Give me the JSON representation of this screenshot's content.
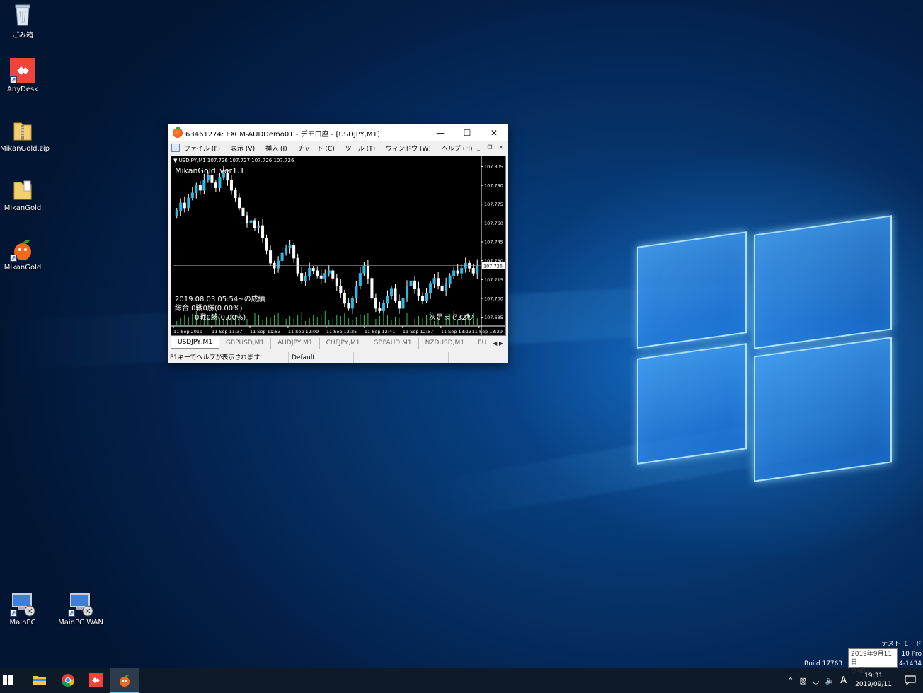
{
  "desktop": {
    "icons": [
      {
        "name": "recycle-bin",
        "label": "ごみ箱"
      },
      {
        "name": "anydesk",
        "label": "AnyDesk"
      },
      {
        "name": "mikangold-zip",
        "label": "MikanGold.zip"
      },
      {
        "name": "mikangold-folder",
        "label": "MikanGold"
      },
      {
        "name": "mikangold-app",
        "label": "MikanGold"
      },
      {
        "name": "mainpc",
        "label": "MainPC"
      },
      {
        "name": "mainpc-wan",
        "label": "MainPC WAN"
      }
    ],
    "watermark": {
      "line1": "テスト モード",
      "line2": "10 Pro",
      "line3_prefix": "Build 17763",
      "line3_suffix": "4-1434"
    }
  },
  "mt4": {
    "title": "63461274: FXCM-AUDDemo01 - デモ口座 - [USDJPY,M1]",
    "menu": [
      "ファイル (F)",
      "表示 (V)",
      "挿入 (I)",
      "チャート (C)",
      "ツール (T)",
      "ウィンドウ (W)",
      "ヘルプ (H)"
    ],
    "chart": {
      "header": "USDJPY,M1  107.726 107.727 107.726 107.726",
      "ea_name": "MikanGold_ver1.1",
      "stats_line1": "2019.08.03 05:54~の成績",
      "stats_line2": "総合 0戦0勝(0.00%)",
      "stats_line3": "0戦0勝(0.00%)",
      "countdown": "次足まで32秒",
      "current_price": "107.726"
    },
    "tabs": [
      "USDJPY,M1",
      "GBPUSD,M1",
      "AUDJPY,M1",
      "CHFJPY,M1",
      "GBPAUD,M1",
      "NZDUSD,M1",
      "EU"
    ],
    "active_tab": 0,
    "status": {
      "help": "F1キーでヘルプが表示されます",
      "profile": "Default"
    }
  },
  "chart_data": {
    "type": "candlestick",
    "symbol": "USDJPY",
    "timeframe": "M1",
    "ylim": [
      107.678,
      107.812
    ],
    "y_ticks": [
      "107.805",
      "107.790",
      "107.775",
      "107.760",
      "107.745",
      "107.730",
      "107.715",
      "107.700",
      "107.685"
    ],
    "x_ticks": [
      "11 Sep 2019",
      "11 Sep 11:37",
      "11 Sep 11:53",
      "11 Sep 12:09",
      "11 Sep 12:25",
      "11 Sep 12:41",
      "11 Sep 12:57",
      "11 Sep 13:13",
      "11 Sep 13:29"
    ],
    "bid_line": 107.726,
    "close": [
      107.77,
      107.776,
      107.772,
      107.78,
      107.784,
      107.79,
      107.786,
      107.794,
      107.798,
      107.792,
      107.788,
      107.796,
      107.8,
      107.794,
      107.786,
      107.78,
      107.772,
      107.766,
      107.76,
      107.762,
      107.756,
      107.758,
      107.748,
      107.738,
      107.728,
      107.724,
      107.73,
      107.736,
      107.74,
      107.742,
      107.732,
      107.72,
      107.714,
      107.718,
      107.724,
      107.722,
      107.718,
      107.716,
      107.72,
      107.722,
      107.716,
      107.71,
      107.704,
      107.696,
      107.692,
      107.7,
      107.71,
      107.72,
      107.726,
      107.716,
      107.7,
      107.692,
      107.69,
      107.696,
      107.702,
      107.708,
      107.698,
      107.692,
      107.7,
      107.71,
      107.714,
      107.708,
      107.702,
      107.698,
      107.704,
      107.712,
      107.716,
      107.71,
      107.706,
      107.712,
      107.718,
      107.722,
      107.72,
      107.724,
      107.728,
      107.724,
      107.72,
      107.726
    ]
  }
}
